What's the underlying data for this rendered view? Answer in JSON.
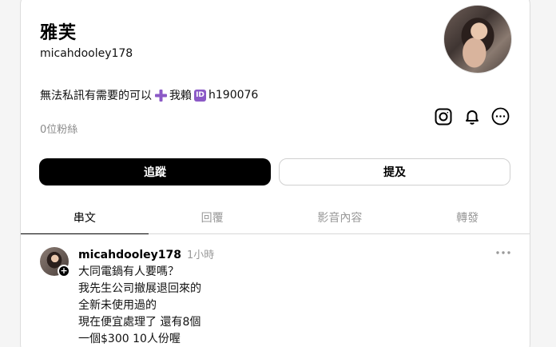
{
  "profile": {
    "display_name": "雅芙",
    "username": "micahdooley178",
    "bio_part1": "無法私訊有需要的可以",
    "bio_part2": "我賴",
    "bio_id_badge": "ID",
    "bio_part3": "h190076",
    "followers": "0位粉絲"
  },
  "icons": {
    "instagram": "instagram-icon",
    "notifications": "bell-icon",
    "more": "more-icon"
  },
  "buttons": {
    "follow": "追蹤",
    "mention": "提及"
  },
  "tabs": [
    {
      "label": "串文",
      "active": true
    },
    {
      "label": "回覆",
      "active": false
    },
    {
      "label": "影音內容",
      "active": false
    },
    {
      "label": "轉發",
      "active": false
    }
  ],
  "post": {
    "username": "micahdooley178",
    "time": "1小時",
    "lines": [
      "大同電鍋有人要嗎？",
      "我先生公司撤展退回來的",
      "全新未使用過的",
      "現在便宜處理了 還有8個",
      "一個$300 10人份喔"
    ]
  },
  "colors": {
    "accent_black": "#000000",
    "muted_text": "#999999",
    "plus_emoji": "#8b59c6",
    "id_badge": "#8b59c6"
  }
}
